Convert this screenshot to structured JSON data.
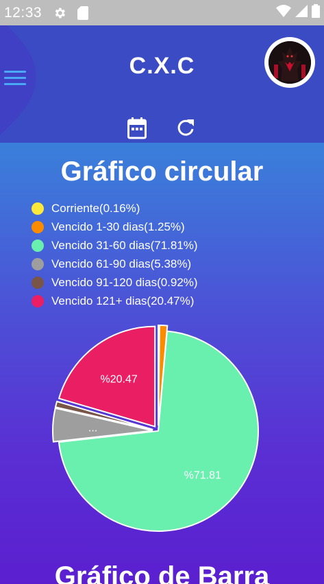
{
  "status_bar": {
    "time": "12:33"
  },
  "header": {
    "title": "C.X.C"
  },
  "pie_section": {
    "title": "Gráfico circular"
  },
  "bar_section": {
    "title": "Gráfico de Barra"
  },
  "colors": {
    "header_bg": "#3a4bc4",
    "accent": "#4aa8f5"
  },
  "chart_data": {
    "type": "pie",
    "title": "Gráfico circular",
    "legend_position": "top-left",
    "series": [
      {
        "name": "Corriente(0.16%)",
        "value": 0.16,
        "color": "#fde93b",
        "label": ""
      },
      {
        "name": "Vencido 1-30 dias(1.25%)",
        "value": 1.25,
        "color": "#fb8c00",
        "label": ""
      },
      {
        "name": "Vencido 31-60 dias(71.81%)",
        "value": 71.81,
        "color": "#69f0ae",
        "label": "%71.81"
      },
      {
        "name": "Vencido 61-90 dias(5.38%)",
        "value": 5.38,
        "color": "#9e9e9e",
        "label": "..."
      },
      {
        "name": "Vencido 91-120 dias(0.92%)",
        "value": 0.92,
        "color": "#795548",
        "label": ""
      },
      {
        "name": "Vencido 121+ dias(20.47%)",
        "value": 20.47,
        "color": "#e91e63",
        "label": "%20.47"
      }
    ]
  }
}
